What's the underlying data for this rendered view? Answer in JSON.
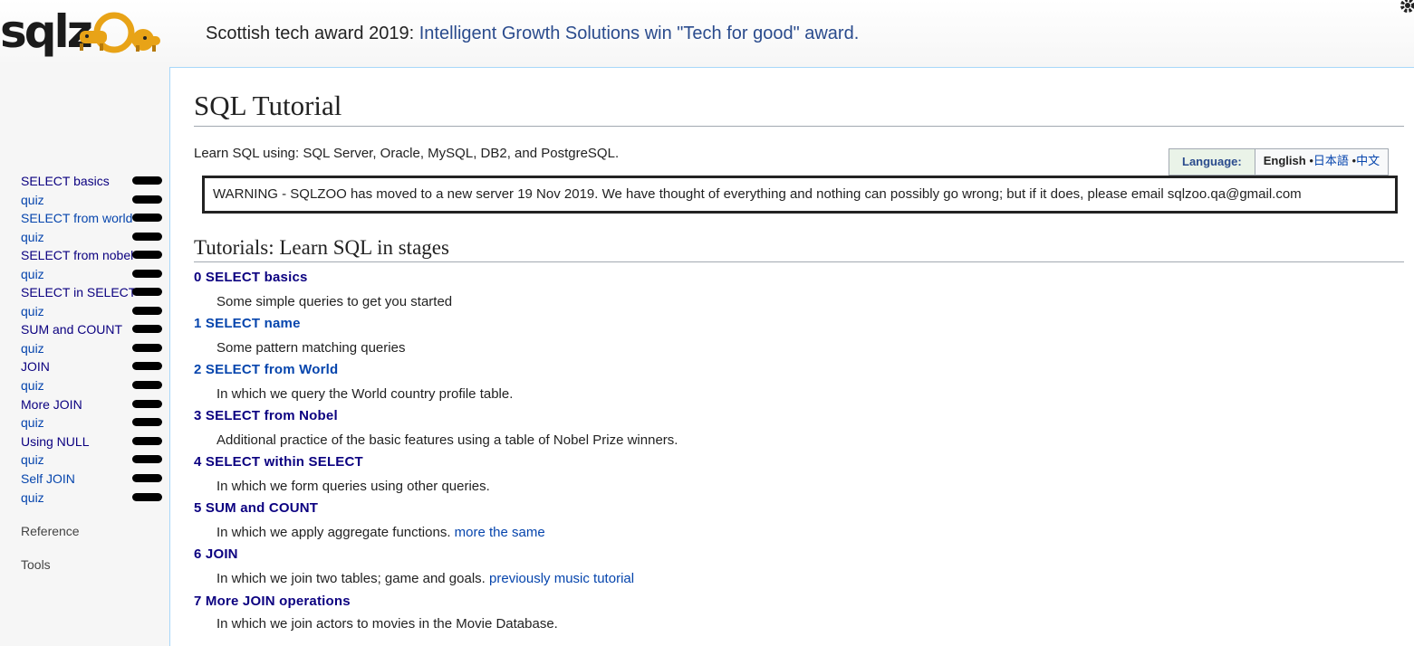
{
  "header": {
    "logo_text": "SQLZOO",
    "notice_prefix": "Scottish tech award 2019:",
    "notice_link": "Intelligent Growth Solutions win \"Tech for good\" award."
  },
  "sidebar": {
    "items": [
      {
        "label": "SELECT basics"
      },
      {
        "label": "quiz"
      },
      {
        "label": "SELECT from world"
      },
      {
        "label": "quiz"
      },
      {
        "label": "SELECT from nobel"
      },
      {
        "label": "quiz"
      },
      {
        "label": "SELECT in SELECT"
      },
      {
        "label": "quiz"
      },
      {
        "label": "SUM and COUNT"
      },
      {
        "label": "quiz"
      },
      {
        "label": "JOIN"
      },
      {
        "label": "quiz"
      },
      {
        "label": "More JOIN"
      },
      {
        "label": "quiz"
      },
      {
        "label": "Using NULL"
      },
      {
        "label": "quiz"
      },
      {
        "label": "Self JOIN"
      },
      {
        "label": "quiz"
      }
    ],
    "portals": [
      "Reference",
      "Tools"
    ]
  },
  "content": {
    "title": "SQL Tutorial",
    "intro": "Learn SQL using: SQL Server, Oracle, MySQL, DB2, and PostgreSQL.",
    "language": {
      "label": "Language:",
      "current": "English",
      "others": [
        "日本語",
        "中文"
      ],
      "separator": "•"
    },
    "warning": "WARNING - SQLZOO has moved to a new server 19 Nov 2019. We have thought of everything and nothing can possibly go wrong; but if it does, please email sqlzoo.qa@gmail.com",
    "section_heading": "Tutorials: Learn SQL in stages",
    "tutorials": [
      {
        "title": "0 SELECT basics",
        "desc": "Some simple queries to get you started",
        "extra": ""
      },
      {
        "title": "1 SELECT name",
        "desc": "Some pattern matching queries",
        "extra": ""
      },
      {
        "title": "2 SELECT from World",
        "desc": "In which we query the World country profile table.",
        "extra": ""
      },
      {
        "title": "3 SELECT from Nobel",
        "desc": "Additional practice of the basic features using a table of Nobel Prize winners.",
        "extra": ""
      },
      {
        "title": "4 SELECT within SELECT",
        "desc": "In which we form queries using other queries.",
        "extra": ""
      },
      {
        "title": "5 SUM and COUNT",
        "desc": "In which we apply aggregate functions.",
        "extra": "more the same"
      },
      {
        "title": "6 JOIN",
        "desc": "In which we join two tables; game and goals.",
        "extra": "previously music tutorial"
      },
      {
        "title": "7 More JOIN operations",
        "desc": "In which we join actors to movies in the Movie Database.",
        "extra": ""
      }
    ]
  },
  "colors": {
    "link": "#0645ad",
    "visited_link": "#0b0080",
    "content_border": "#a7d7f9",
    "logo_orange": "#e8a317"
  }
}
